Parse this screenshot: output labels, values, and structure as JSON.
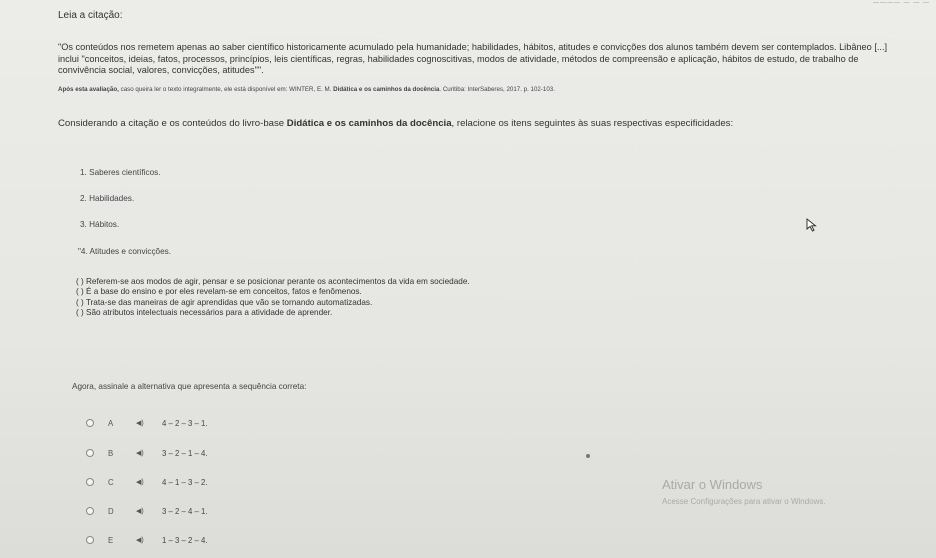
{
  "header": {
    "title": "Leia a citação:",
    "top_right_text": "———— — — —"
  },
  "quote": {
    "line1": "\"Os conteúdos nos remetem apenas ao saber científico historicamente acumulado pela humanidade; habilidades, hábitos, atitudes e convicções dos alunos também devem ser contemplados. Libâneo [...]",
    "line2": "inclui \"conceitos, ideias, fatos, processos, princípios, leis científicas, regras, habilidades cognoscitivas, modos de atividade, métodos de compreensão e aplicação, hábitos de estudo, de trabalho de",
    "line3": "convivência social, valores, convicções, atitudes\"\"."
  },
  "source": {
    "bold_lead": "Após esta avaliação,",
    "text": " caso queira ler o texto integralmente, ele está disponível em: WINTER, E. M. ",
    "bold_title": "Didática e os caminhos da docência",
    "tail": ". Curitiba: InterSaberes, 2017. p. 102-103."
  },
  "instruction": {
    "pre": "Considerando a citação e os conteúdos do livro-base ",
    "bold": "Didática e os caminhos da docência",
    "post": ", relacione os itens seguintes às suas respectivas especificidades:"
  },
  "items": [
    "1. Saberes científicos.",
    "2. Habilidades.",
    "3. Hábitos.",
    "\"4. Atitudes e convicções."
  ],
  "associations": [
    "( ) Referem-se aos modos de agir, pensar e se posicionar perante os acontecimentos da vida em sociedade.",
    "( ) É a base do ensino e por eles revelam-se em conceitos, fatos e fenômenos.",
    "( ) Trata-se das maneiras de agir aprendidas que vão se tornando automatizadas.",
    "( ) São atributos intelectuais necessários para a atividade de aprender."
  ],
  "question": "Agora, assinale a alternativa que apresenta a sequência correta:",
  "options": [
    {
      "letter": "A",
      "audio_icon": "speaker-icon",
      "sequence": "4 – 2 – 3 – 1."
    },
    {
      "letter": "B",
      "audio_icon": "speaker-icon",
      "sequence": "3 – 2 – 1 – 4."
    },
    {
      "letter": "C",
      "audio_icon": "speaker-icon",
      "sequence": "4 – 1 – 3 – 2."
    },
    {
      "letter": "D",
      "audio_icon": "speaker-icon",
      "sequence": "3 – 2 – 4 – 1."
    },
    {
      "letter": "E",
      "audio_icon": "speaker-icon",
      "sequence": "1 – 3 – 2 – 4."
    }
  ],
  "watermark": {
    "title": "Ativar o Windows",
    "subtitle": "Acesse Configurações para ativar o Windows."
  },
  "colors": {
    "background": "#e8e8e6",
    "text": "#333333",
    "watermark": "#a9a9a7"
  }
}
